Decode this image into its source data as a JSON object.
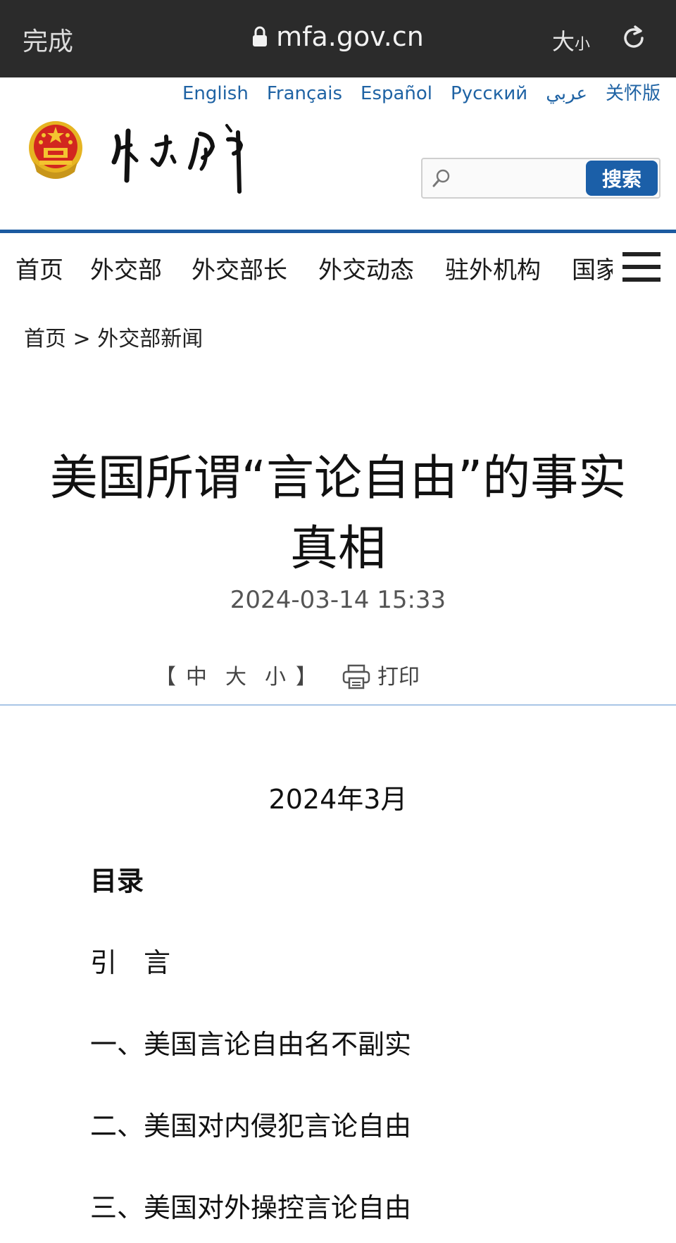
{
  "browser": {
    "done_label": "完成",
    "url": "mfa.gov.cn",
    "text_size_large": "大",
    "text_size_small": "小"
  },
  "languages": [
    "English",
    "Français",
    "Español",
    "Русский",
    "عربي",
    "关怀版"
  ],
  "search": {
    "placeholder": "",
    "button_label": "搜索"
  },
  "nav": {
    "items": [
      "首页",
      "外交部",
      "外交部长",
      "外交动态",
      "驻外机构",
      "国家"
    ]
  },
  "breadcrumb": {
    "home": "首页",
    "separator": ">",
    "current": "外交部新闻"
  },
  "article": {
    "title": "美国所谓“言论自由”的事实真相",
    "datetime": "2024-03-14 15:33",
    "font_tools": {
      "open": "【",
      "medium": "中",
      "large": "大",
      "small": "小",
      "close": "】"
    },
    "print_label": "打印",
    "pub_date": "2024年3月",
    "toc_heading": "目录",
    "toc": [
      "引　言",
      "一、美国言论自由名不副实",
      "二、美国对内侵犯言论自由",
      "三、美国对外操控言论自由"
    ]
  },
  "colors": {
    "accent_blue": "#1b5fa8",
    "browser_bar": "#2b2b2b",
    "link_blue": "#1f63a4"
  }
}
